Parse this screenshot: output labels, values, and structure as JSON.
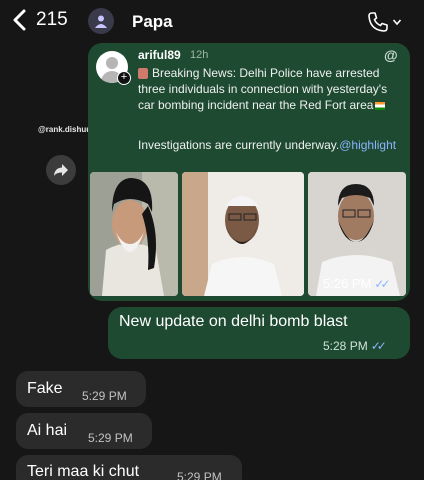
{
  "header": {
    "back_count": "215",
    "contact_name": "Papa"
  },
  "watermark": "@rank.dishuu",
  "threads_post": {
    "username": "ariful89",
    "age": "12h",
    "text": "Breaking News: Delhi Police have arrested three individuals in connection with yesterday's car bombing incident near the Red Fort area",
    "text2_prefix": "Investigations are currently underway.",
    "mention": "@highlight"
  },
  "messages": {
    "image_time": "5:26 PM",
    "outgoing_text": "New update on delhi bomb blast",
    "outgoing_time": "5:28 PM",
    "incoming": [
      {
        "text": "Fake",
        "time": "5:29 PM"
      },
      {
        "text": "Ai hai",
        "time": "5:29 PM"
      },
      {
        "text": "Teri maa ki chut",
        "time": "5:29 PM"
      }
    ]
  },
  "colors": {
    "background": "#161616",
    "outgoing_bubble": "#1d4a30",
    "incoming_bubble": "#2b2b2b",
    "read_ticks": "#8ab4ff"
  },
  "icons": [
    "back-chevron-icon",
    "profile-icon",
    "phone-icon",
    "chevron-down-icon",
    "forward-icon",
    "threads-icon",
    "read-ticks-icon"
  ]
}
